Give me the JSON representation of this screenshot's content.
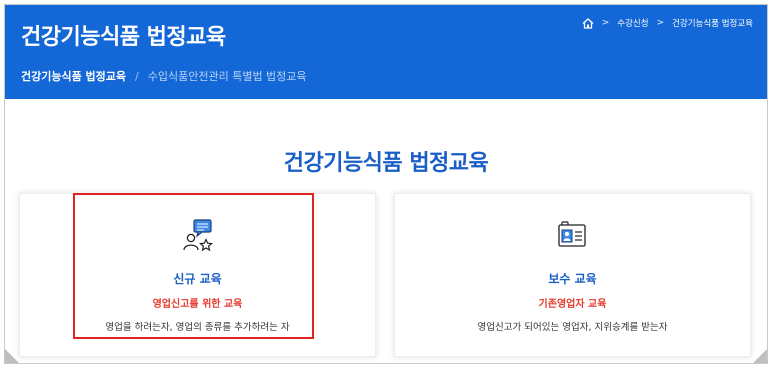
{
  "header": {
    "title": "건강기능식품 법정교육",
    "bg_color": "#1467d6",
    "top_nav": {
      "home_icon": "home-icon",
      "items": [
        "수강신청",
        "건강기능식품 법정교육"
      ]
    },
    "breadcrumb": {
      "current": "건강기능식품 법정교육",
      "separator": "/",
      "next": "수입식품안전관리 특별법 법정교육"
    }
  },
  "main": {
    "section_title": "건강기능식품 법정교육",
    "cards": [
      {
        "icon": "chat-person-star-icon",
        "title": "신규 교육",
        "subtitle": "영업신고를 위한 교육",
        "description": "영업을 하려는자, 영업의 종류를 추가하려는 자",
        "highlighted": true
      },
      {
        "icon": "id-card-icon",
        "title": "보수 교육",
        "subtitle": "기존영업자 교육",
        "description": "영업신고가 되어있는 영업자, 지위승계를 받는자",
        "highlighted": false
      }
    ]
  },
  "colors": {
    "accent": "#1a5fc6",
    "subtitle_red": "#e63b2e",
    "highlight_border": "#e22222"
  }
}
